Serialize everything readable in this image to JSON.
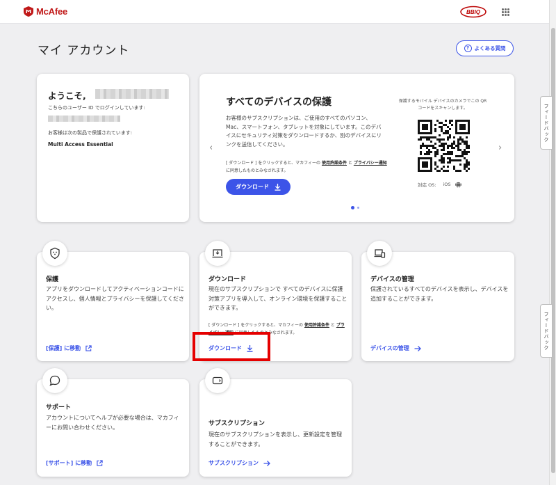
{
  "header": {
    "brand": "McAfee",
    "partner_logo": "BBIQ"
  },
  "page": {
    "title": "マイ アカウント",
    "faq_label": "よくある質問"
  },
  "welcome": {
    "greeting": "ようこそ,",
    "login_note": "こちらのユーザー ID でログインしています:",
    "protected_note": "お客様は次の製品で保護されています:",
    "product": "Multi Access Essential"
  },
  "promo": {
    "title": "すべてのデバイスの保護",
    "description": "お客様のサブスクリプションは、ご使用のすべてのパソコン、Mac、スマートフォン、タブレットを対象にしています。このデバイスにセキュリティ対策をダウンロードするか、別のデバイスにリンクを送信してください。",
    "legal_1": "[ ダウンロード ] をクリックすると、マカフィーの",
    "legal_terms": "使用許諾条件",
    "legal_and": "と",
    "legal_privacy": "プライバシー通知",
    "legal_2": "に同意したものとみなされます。",
    "download_label": "ダウンロード",
    "qr_caption": "保護するモバイル デバイスのカメラでこの QR コードをスキャンします。",
    "os_label": "対応 OS:",
    "os_ios": "iOS",
    "prev_arrow": "‹",
    "next_arrow": "›"
  },
  "tiles": {
    "protect": {
      "title": "保護",
      "desc": "アプリをダウンロードしてアクティベーションコードにアクセスし、個人情報とプライバシーを保護してください。",
      "link": "[保護] に移動"
    },
    "download": {
      "title": "ダウンロード",
      "desc": "現在のサブスクリプションで すべてのデバイスに保護対策アプリを導入して、オンライン環境を保護することができます。",
      "legal_1": "[ ダウンロード ] をクリックすると、マカフィーの",
      "legal_terms": "使用許諾条件",
      "legal_and": "と",
      "legal_privacy": "プライバシー通知",
      "legal_2": "に同意したものとみなされます。",
      "link": "ダウンロード"
    },
    "devices": {
      "title": "デバイスの管理",
      "desc": "保護されているすべてのデバイスを表示し、デバイスを追加することができます。",
      "link": "デバイスの管理"
    },
    "support": {
      "title": "サポート",
      "desc": "アカウントについてヘルプが必要な場合は、マカフィーにお問い合わせください。",
      "link": "[サポート] に移動"
    },
    "subscription": {
      "title": "サブスクリプション",
      "desc": "現在のサブスクリプションを表示し、更新設定を管理することができます。",
      "link": "サブスクリプション"
    }
  },
  "feedback_label": "フィードバック",
  "colors": {
    "accent": "#3c54e8",
    "brand": "#c01818",
    "highlight": "#e50000"
  },
  "icons": [
    "mcafee-shield-icon",
    "apps-grid-icon",
    "question-icon",
    "download-icon",
    "external-link-icon",
    "arrow-right-icon",
    "shield-icon",
    "laptop-download-icon",
    "devices-icon",
    "chat-bubble-icon",
    "card-icon",
    "android-icon",
    "chevron-left-icon",
    "chevron-right-icon"
  ]
}
